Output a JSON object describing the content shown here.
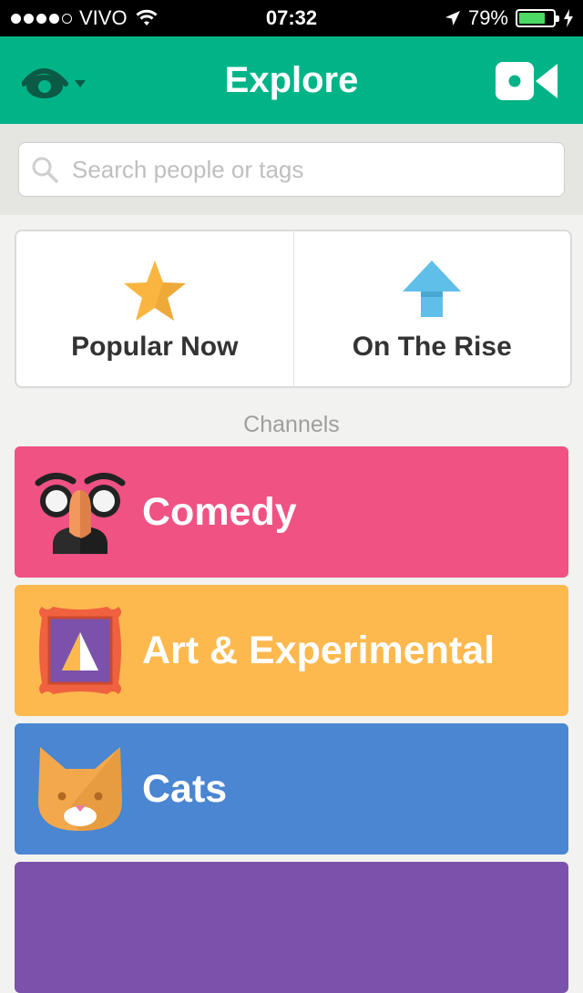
{
  "status_bar": {
    "carrier": "VIVO",
    "time": "07:32",
    "battery_percent": "79%",
    "battery_level": 0.79
  },
  "nav": {
    "title": "Explore",
    "left_icon": "eye-icon",
    "right_icon": "video-camera-icon"
  },
  "search": {
    "placeholder": "Search people or tags"
  },
  "featured": [
    {
      "label": "Popular Now",
      "icon": "star-icon"
    },
    {
      "label": "On The Rise",
      "icon": "up-arrow-icon"
    }
  ],
  "channels_title": "Channels",
  "channels": [
    {
      "label": "Comedy",
      "color": "#ef5283",
      "icon": "groucho-glasses-icon"
    },
    {
      "label": "Art & Experimental",
      "color": "#fdb94e",
      "icon": "framed-painting-icon"
    },
    {
      "label": "Cats",
      "color": "#4a86d1",
      "icon": "cat-face-icon"
    },
    {
      "label": "",
      "color": "#7b52ab"
    }
  ],
  "colors": {
    "brand_green": "#00b488",
    "star": "#f9b53f",
    "arrow": "#5fbfe9"
  }
}
